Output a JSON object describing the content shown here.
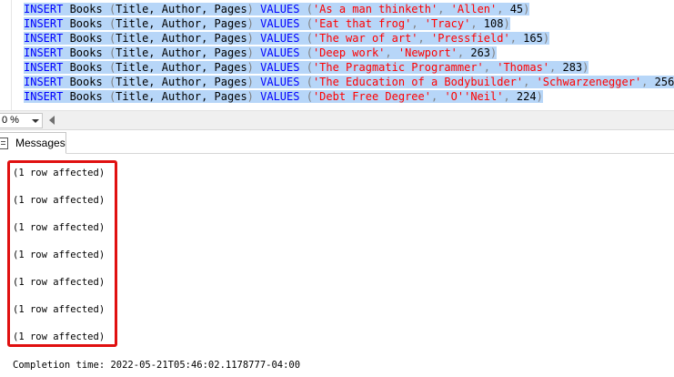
{
  "editor": {
    "lines": [
      {
        "kw": "INSERT",
        "table": " Books ",
        "open": "(",
        "cols": "Title, Author, Pages",
        "close": ")",
        "values_kw": " VALUES ",
        "vopen": "(",
        "title": "'As a man thinketh'",
        "sep1": ", ",
        "author": "'Allen'",
        "sep2": ", ",
        "pages": "45",
        "vclose": ")"
      },
      {
        "kw": "INSERT",
        "table": " Books ",
        "open": "(",
        "cols": "Title, Author, Pages",
        "close": ")",
        "values_kw": " VALUES ",
        "vopen": "(",
        "title": "'Eat that frog'",
        "sep1": ", ",
        "author": "'Tracy'",
        "sep2": ", ",
        "pages": "108",
        "vclose": ")"
      },
      {
        "kw": "INSERT",
        "table": " Books ",
        "open": "(",
        "cols": "Title, Author, Pages",
        "close": ")",
        "values_kw": " VALUES ",
        "vopen": "(",
        "title": "'The war of art'",
        "sep1": ", ",
        "author": "'Pressfield'",
        "sep2": ", ",
        "pages": "165",
        "vclose": ")"
      },
      {
        "kw": "INSERT",
        "table": " Books ",
        "open": "(",
        "cols": "Title, Author, Pages",
        "close": ")",
        "values_kw": " VALUES ",
        "vopen": "(",
        "title": "'Deep work'",
        "sep1": ", ",
        "author": "'Newport'",
        "sep2": ", ",
        "pages": "263",
        "vclose": ")"
      },
      {
        "kw": "INSERT",
        "table": " Books ",
        "open": "(",
        "cols": "Title, Author, Pages",
        "close": ")",
        "values_kw": " VALUES ",
        "vopen": "(",
        "title": "'The Pragmatic Programmer'",
        "sep1": ", ",
        "author": "'Thomas'",
        "sep2": ", ",
        "pages": "283",
        "vclose": ")"
      },
      {
        "kw": "INSERT",
        "table": " Books ",
        "open": "(",
        "cols": "Title, Author, Pages",
        "close": ")",
        "values_kw": " VALUES ",
        "vopen": "(",
        "title": "'The Education of a Bodybuilder'",
        "sep1": ", ",
        "author": "'Schwarzenegger'",
        "sep2": ", ",
        "pages": "256",
        "vclose": ")"
      },
      {
        "kw": "INSERT",
        "table": " Books ",
        "open": "(",
        "cols": "Title, Author, Pages",
        "close": ")",
        "values_kw": " VALUES ",
        "vopen": "(",
        "title": "'Debt Free Degree'",
        "sep1": ", ",
        "author": "'O''Neil'",
        "sep2": ", ",
        "pages": "224",
        "vclose": ")"
      }
    ]
  },
  "zoom": {
    "value": "0 %"
  },
  "tabs": {
    "messages_label": "Messages"
  },
  "messages": {
    "rows": [
      "(1 row affected)",
      "(1 row affected)",
      "(1 row affected)",
      "(1 row affected)",
      "(1 row affected)",
      "(1 row affected)",
      "(1 row affected)"
    ],
    "completion": "Completion time: 2022-05-21T05:46:02.1178777-04:00"
  },
  "colors": {
    "keyword": "#0000ff",
    "string": "#ff0000",
    "selection": "#b7d6f8",
    "highlight_border": "#e01010"
  }
}
